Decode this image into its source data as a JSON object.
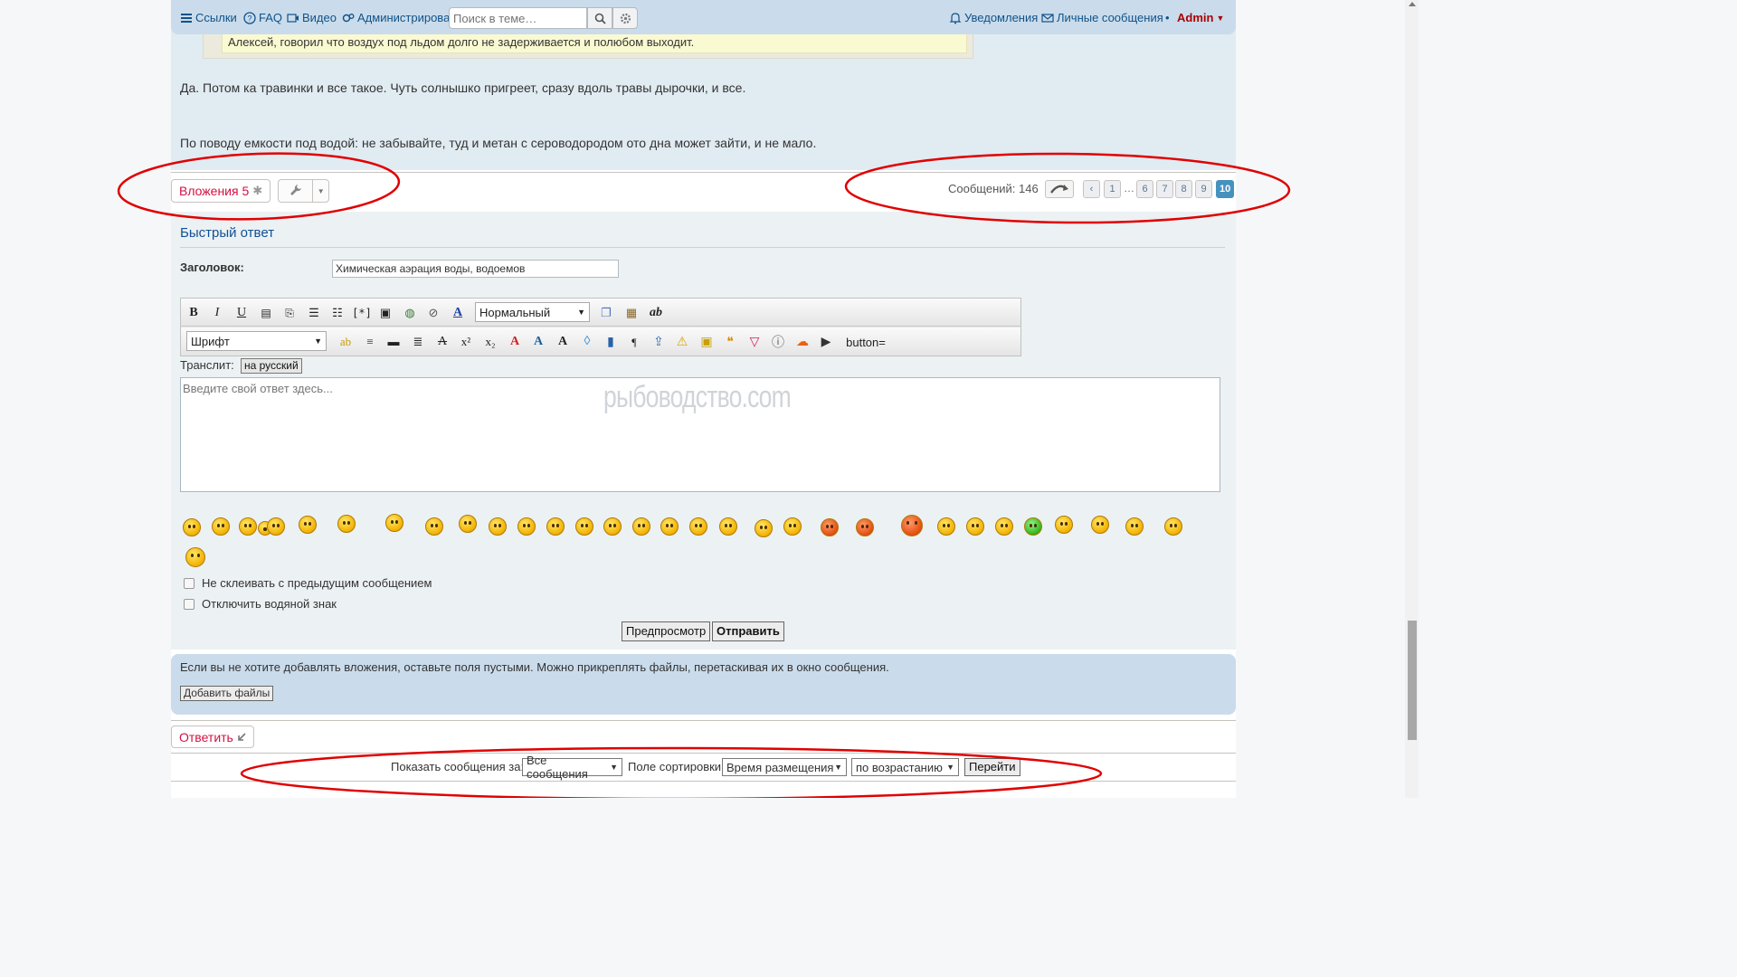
{
  "nav": {
    "links_label": "Ссылки",
    "faq_label": "FAQ",
    "video_label": "Видео",
    "admin_label": "Администрирова",
    "search_placeholder": "Поиск в теме…",
    "notifications_label": "Уведомления",
    "messages_label": "Личные сообщения",
    "user_label": "Admin"
  },
  "post": {
    "quote_text": "Алексей, говорил что воздух под льдом долго не задерживается и полюбом выходит.",
    "paragraph1": "Да. Потом ка травинки и все такое. Чуть солнышко пригреет, сразу вдоль травы дырочки, и все.",
    "paragraph2": "По поводу емкости под водой: не забывайте, туд и метан с сероводородом ото дна может зайти, и не мало."
  },
  "actions": {
    "attachments_label": "Вложения 5"
  },
  "pagination": {
    "count_label": "Сообщений: 146",
    "pages": [
      "1",
      "6",
      "7",
      "8",
      "9",
      "10"
    ],
    "ellipsis": "…",
    "active_page": "10"
  },
  "quick_reply": {
    "title": "Быстрый ответ",
    "subject_label": "Заголовок:",
    "subject_value": "Химическая аэрация воды, водоемов",
    "size_select": "Нормальный",
    "font_select": "Шрифт",
    "button_eq_label": "button=",
    "translit_label": "Транслит:",
    "translit_button": "на русский",
    "textarea_placeholder": "Введите свой ответ здесь...",
    "watermark": "рыбоводство.com",
    "checkbox1": "Не склеивать с предыдущим сообщением",
    "checkbox2": "Отключить водяной знак",
    "preview_button": "Предпросмотр",
    "submit_button": "Отправить"
  },
  "attachments_panel": {
    "note": "Если вы не хотите добавлять вложения, оставьте поля пустыми. Можно прикреплять файлы, перетаскивая их в окно сообщения.",
    "add_files_button": "Добавить файлы"
  },
  "reply_button": "Ответить",
  "sort": {
    "show_label": "Показать сообщения за:",
    "show_value": "Все сообщения",
    "sort_label": "Поле сортировки",
    "sort_value": "Время размещения",
    "order_value": "по возрастанию",
    "go_button": "Перейти"
  },
  "colors": {
    "navbar": "#cadceb",
    "link": "#105289",
    "accent_red": "#d31141",
    "active_page": "#4692bf",
    "annotation": "#e00000"
  }
}
